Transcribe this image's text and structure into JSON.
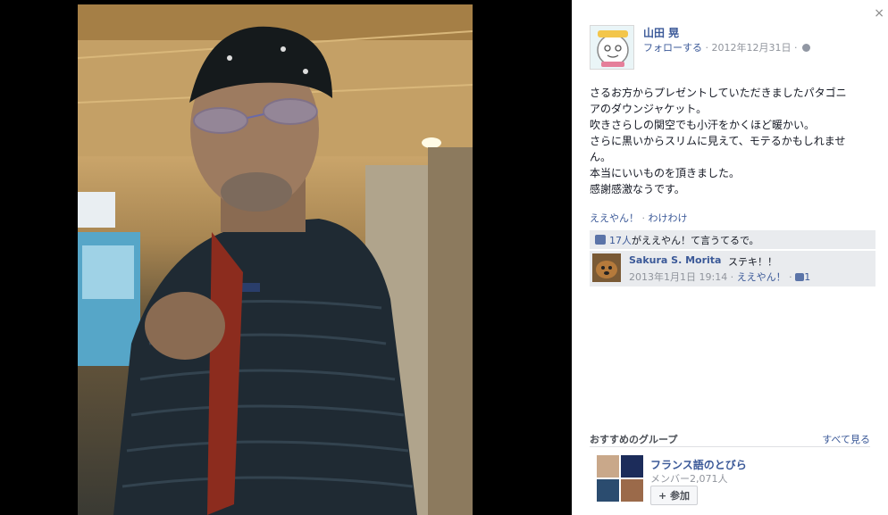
{
  "photo": {
    "description_icon": "photo"
  },
  "panel": {
    "close_icon": "×",
    "author": "山田 晃",
    "follow": "フォローする",
    "date": " · 2012年12月31日 · ",
    "post_lines": [
      "さるお方からプレゼントしていただきましたパタゴニ",
      "アのダウンジャケット。",
      "吹きさらしの関空でも小汗をかくほど暖かい。",
      "さらに黒いからスリムに見えて、モテるかもしれませ",
      "ん。",
      "本当にいいものを頂きました。",
      "感謝感激なうです。"
    ],
    "action_like": "ええやん！",
    "action_sep": " · ",
    "action_share": "わけわけ",
    "likes_count": "17人",
    "likes_text": "がええやん！て言うてるで。",
    "comment": {
      "name": "Sakura S. Morita",
      "text": "ステキ！！",
      "time": "2013年1月1日 19:14 · ",
      "like": "ええやん！",
      "sep": " · ",
      "like_count": "1"
    },
    "groups": {
      "title": "おすすめのグループ",
      "see_all": "すべて見る",
      "name": "フランス語のとびら",
      "members": "メンバー2,071人",
      "join": "+ 参加"
    }
  },
  "colors": {
    "link": "#3b5998",
    "meta": "#90949c",
    "bg_gray": "#e9ebee"
  }
}
